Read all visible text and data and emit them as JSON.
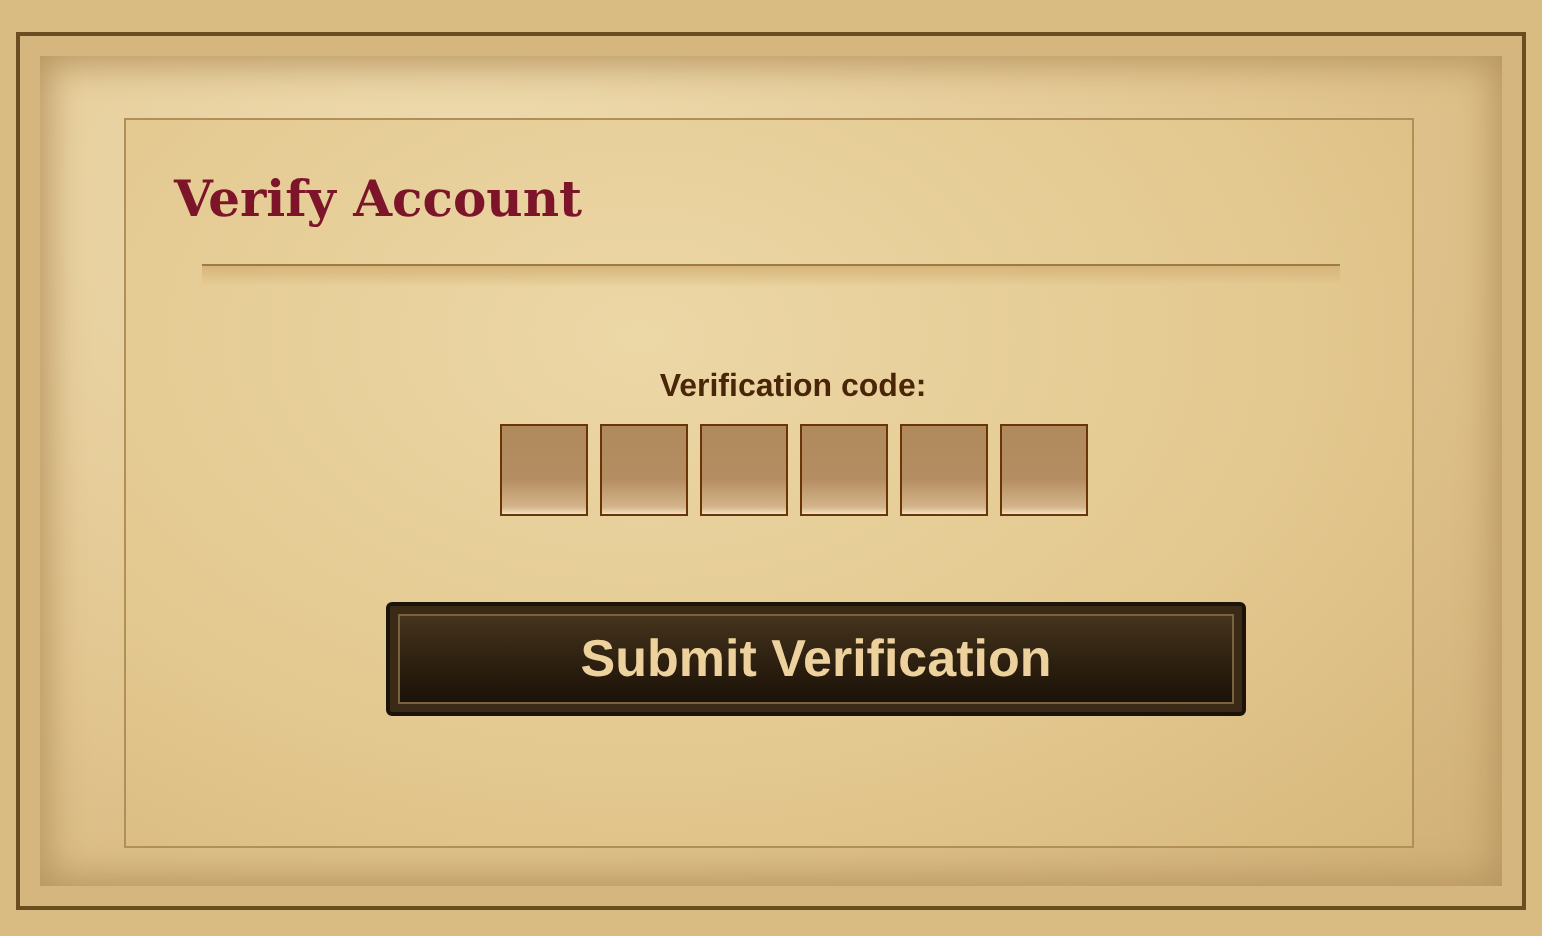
{
  "title": "Verify Account",
  "code_label": "Verification code:",
  "code_fields": [
    {
      "kind": "digit"
    },
    {
      "kind": "digit"
    },
    {
      "kind": "digit"
    },
    {
      "kind": "digit"
    },
    {
      "kind": "digit"
    },
    {
      "kind": "digit"
    }
  ],
  "submit_button": "Submit Verification"
}
